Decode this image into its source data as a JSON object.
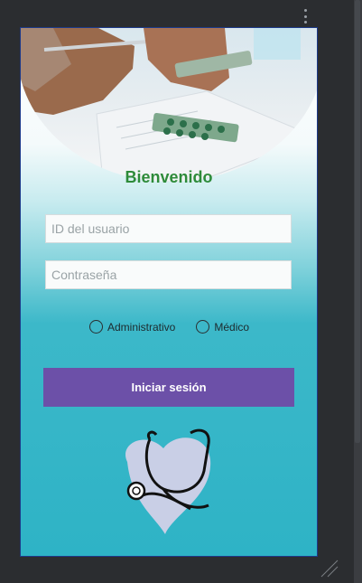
{
  "screen": {
    "welcome_title": "Bienvenido",
    "user_id_placeholder": "ID del usuario",
    "password_placeholder": "Contraseña",
    "roles": [
      "Administrativo",
      "Médico"
    ],
    "login_label": "Iniciar sesión"
  },
  "colors": {
    "title": "#2e8b3a",
    "button": "#6c50a8",
    "background_teal": "#2eb3c6"
  }
}
